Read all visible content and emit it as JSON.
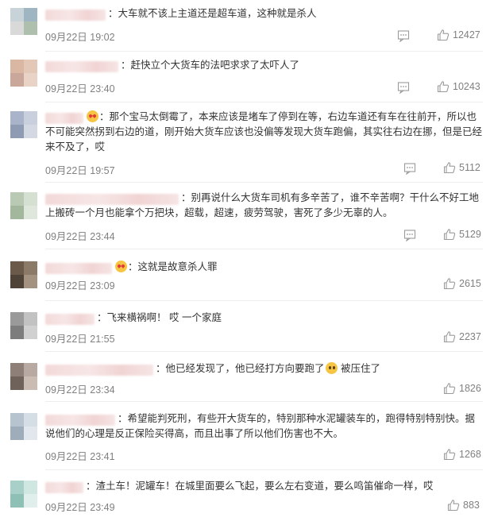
{
  "comments": [
    {
      "text": "：大车就不该上主道还是超车道，这种就是杀人",
      "time": "09月22日 19:02",
      "likes": "12427",
      "avatar_colors": [
        "#c7d3d8",
        "#9fb5c2",
        "#d9d9d9",
        "#aebfae"
      ],
      "emoji": ""
    },
    {
      "text": "：赶快立个大货车的法吧求求了太吓人了",
      "time": "09月22日 23:40",
      "likes": "10243",
      "avatar_colors": [
        "#d9b7a3",
        "#e3c8b8",
        "#c9a79a",
        "#e8d3c6"
      ],
      "emoji": ""
    },
    {
      "text": "：那个宝马太倒霉了，本来应该是堵车了停到在等，右边车道还有车在往前开，所以也不可能突然拐到右边的道，刚开始大货车应该也没偏等发现大货车跑偏，其实往右边在挪，但是已经来不及了，哎",
      "time": "09月22日 19:57",
      "likes": "5112",
      "avatar_colors": [
        "#a9b3c9",
        "#c9cfdc",
        "#8f9ab3",
        "#d4d8e2"
      ],
      "emoji": "heart"
    },
    {
      "text": "：别再说什么大货车司机有多辛苦了，谁不辛苦啊？干什么不好工地上搬砖一个月也能拿个万把块，超载，超速，疲劳驾驶，害死了多少无辜的人。",
      "time": "09月22日 23:44",
      "likes": "5129",
      "avatar_colors": [
        "#b9c9b3",
        "#d6e0d2",
        "#a3b79d",
        "#dfe6dc"
      ],
      "emoji": ""
    },
    {
      "text": "：这就是故意杀人罪",
      "time": "09月22日 23:09",
      "likes": "2615",
      "avatar_colors": [
        "#6b5a4a",
        "#8c7a68",
        "#4f4338",
        "#a3927f"
      ],
      "emoji": "heart"
    },
    {
      "text": "：飞来横祸啊！ 哎 一个家庭",
      "time": "09月22日 21:55",
      "likes": "2237",
      "avatar_colors": [
        "#9a9a9a",
        "#c2c2c2",
        "#7d7d7d",
        "#d0d0d0"
      ],
      "emoji": ""
    },
    {
      "text": "：他已经发现了，他已经打方向要跑了",
      "text_after": " 被压住了",
      "time": "09月22日 23:34",
      "likes": "1826",
      "avatar_colors": [
        "#8e8078",
        "#b8aaa2",
        "#6f625b",
        "#cabcb3"
      ],
      "emoji": "worry"
    },
    {
      "text": "：希望能判死刑，有些开大货车的，特别那种水泥罐装车的，跑得特别特别快。据说他们的心理是反正保险买得高，而且出事了所以他们伤害也不大。",
      "time": "09月22日 23:41",
      "likes": "1268",
      "avatar_colors": [
        "#b7c3cf",
        "#d5dde5",
        "#9fadbb",
        "#e1e7ec"
      ],
      "emoji": ""
    },
    {
      "text": "：渣土车！泥罐车！在城里面要么飞起，要么左右变道，要么鸣笛催命一样，哎",
      "time": "09月22日 23:49",
      "likes": "883",
      "avatar_colors": [
        "#a8d0c8",
        "#cfe6e1",
        "#8fc0b6",
        "#e0efec"
      ],
      "emoji": ""
    }
  ],
  "icons": {
    "reply": "comment-icon",
    "like": "thumbs-up-icon"
  }
}
